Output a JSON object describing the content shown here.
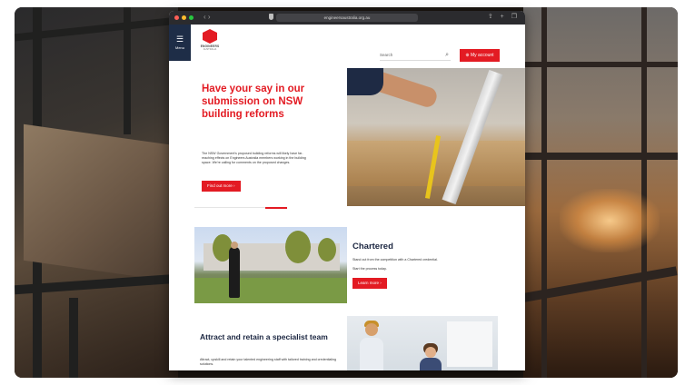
{
  "browser": {
    "url": "engineersaustralia.org.au",
    "nav_arrows": "‹ ›",
    "tools": "⇪ + ❐"
  },
  "header": {
    "menu_label": "Menu",
    "logo_line1": "ENGINEERS",
    "logo_line2": "AUSTRALIA",
    "search_placeholder": "Search",
    "account_label": "⊕ My account"
  },
  "hero": {
    "title": "Have your say in our submission on NSW building reforms",
    "body": "The NSW Government's proposed building reforms will likely have far-reaching effects on Engineers Australia members working in the building space. We're calling for comments on the proposed changes.",
    "button_label": "Find out more ›"
  },
  "chartered": {
    "title": "Chartered",
    "body": "Stand out from the competition with a Chartered credential.",
    "body2": "Start the process today.",
    "button_label": "Learn more ›"
  },
  "attract": {
    "title": "Attract and retain a specialist team",
    "body": "Attract, upskill and retain your talented engineering staff with tailored training and credentialing solutions."
  },
  "colors": {
    "brand_red": "#e31b23",
    "navy": "#1e2d47"
  }
}
